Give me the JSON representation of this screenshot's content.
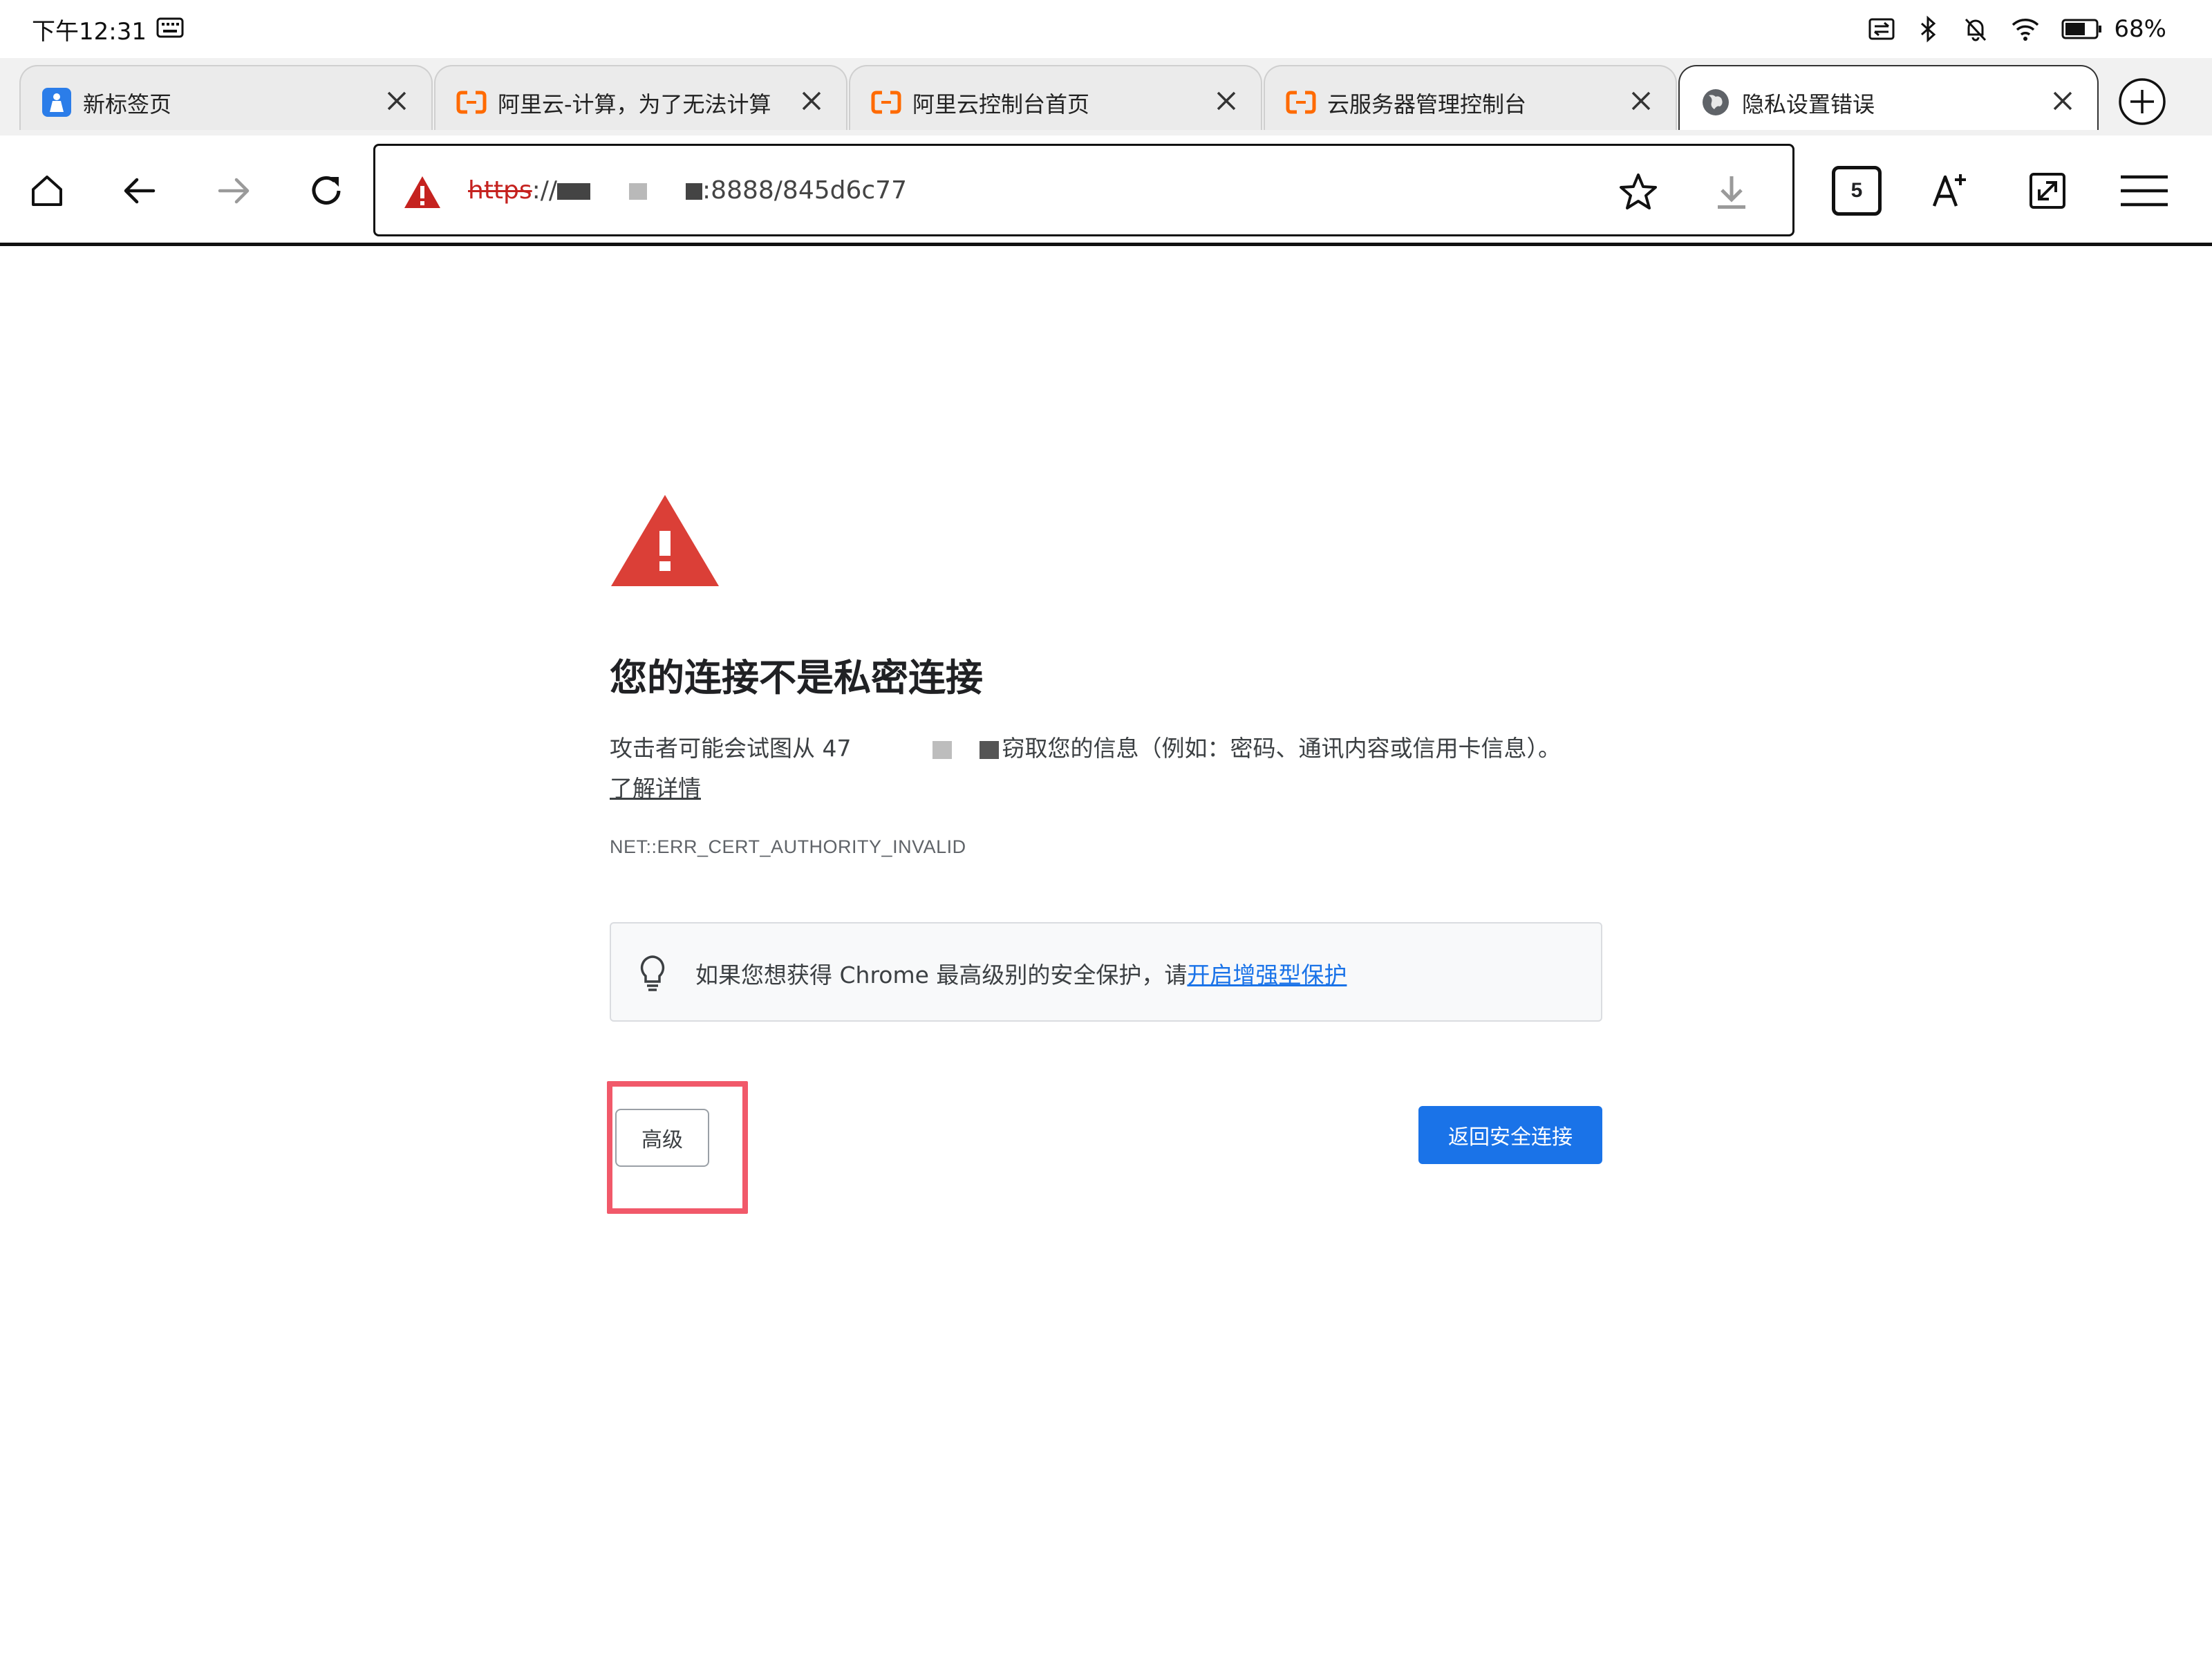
{
  "status_bar": {
    "time": "下午12:31",
    "battery": "68%",
    "icons": [
      "keyboard-icon",
      "cast-icon",
      "bluetooth-icon",
      "bell-off-icon",
      "wifi-icon",
      "battery-icon"
    ]
  },
  "tabs": [
    {
      "title": "新标签页",
      "icon": "new-tab-page-icon",
      "active": false
    },
    {
      "title": "阿里云-计算，为了无法计算",
      "icon": "aliyun-icon",
      "active": false
    },
    {
      "title": "阿里云控制台首页",
      "icon": "aliyun-icon",
      "active": false
    },
    {
      "title": "云服务器管理控制台",
      "icon": "aliyun-icon",
      "active": false
    },
    {
      "title": "隐私设置错误",
      "icon": "globe-icon",
      "active": true
    }
  ],
  "toolbar": {
    "url_scheme": "https",
    "url_sep": "://",
    "url_tail": ":8888/845d6c77",
    "tab_count": "5"
  },
  "interstitial": {
    "heading": "您的连接不是私密连接",
    "desc_part1": "攻击者可能会试图从 47",
    "desc_part2": "窃取您的信息（例如：密码、通讯内容或信用卡信息）。",
    "learn_more": "了解详情",
    "error_code": "NET::ERR_CERT_AUTHORITY_INVALID",
    "tip_text": "如果您想获得 Chrome 最高级别的安全保护，请",
    "tip_link": "开启增强型保护",
    "advanced_label": "高级",
    "back_label": "返回安全连接"
  },
  "colors": {
    "warning_red": "#d93025",
    "link_blue": "#1a73e8",
    "primary_button": "#1a73e8",
    "aliyun_orange": "#ff6a00",
    "highlight": "#f1596a"
  }
}
